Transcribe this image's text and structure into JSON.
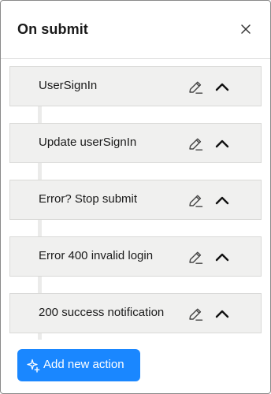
{
  "panel": {
    "title": "On submit",
    "close_icon": "close-icon"
  },
  "actions": [
    {
      "label": "UserSignIn"
    },
    {
      "label": "Update userSignIn"
    },
    {
      "label": "Error? Stop submit"
    },
    {
      "label": "Error 400 invalid login"
    },
    {
      "label": "200 success notification"
    }
  ],
  "action_icons": {
    "edit": "pencil-icon",
    "toggle": "chevron-up-icon"
  },
  "add_button": {
    "label": "Add new action",
    "icon": "sparkle-plus-icon"
  },
  "colors": {
    "accent": "#1a87ff",
    "card_bg": "#f0f0ef",
    "card_border": "#d9d9d7",
    "text": "#1a1a1a"
  }
}
